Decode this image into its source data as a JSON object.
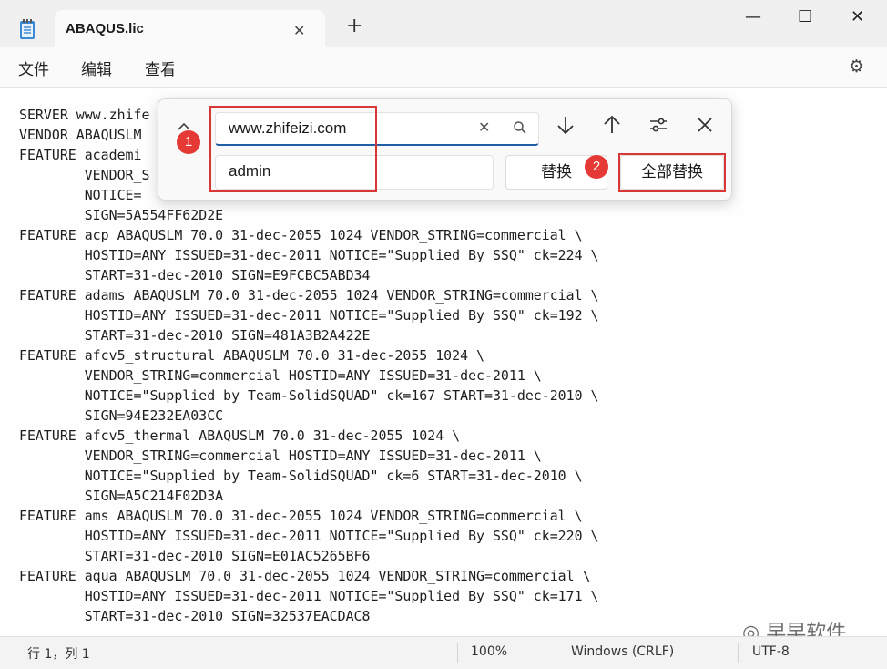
{
  "window": {
    "tab_title": "ABAQUS.lic",
    "tab_close": "✕",
    "new_tab": "+",
    "minimize": "—",
    "maximize": "☐",
    "close": "✕"
  },
  "menu": {
    "file": "文件",
    "edit": "编辑",
    "view": "查看"
  },
  "find_replace": {
    "find_value": "www.zhifeizi.com",
    "replace_value": "admin",
    "replace_label": "替换",
    "replace_all_label": "全部替换",
    "badge_1": "1",
    "badge_2": "2"
  },
  "editor_lines": [
    "SERVER www.zhife",
    "VENDOR ABAQUSLM",
    "FEATURE academi",
    "        VENDOR_S",
    "        NOTICE=",
    "        SIGN=5A554FF62D2E",
    "FEATURE acp ABAQUSLM 70.0 31-dec-2055 1024 VENDOR_STRING=commercial \\",
    "        HOSTID=ANY ISSUED=31-dec-2011 NOTICE=\"Supplied By SSQ\" ck=224 \\",
    "        START=31-dec-2010 SIGN=E9FCBC5ABD34",
    "FEATURE adams ABAQUSLM 70.0 31-dec-2055 1024 VENDOR_STRING=commercial \\",
    "        HOSTID=ANY ISSUED=31-dec-2011 NOTICE=\"Supplied By SSQ\" ck=192 \\",
    "        START=31-dec-2010 SIGN=481A3B2A422E",
    "FEATURE afcv5_structural ABAQUSLM 70.0 31-dec-2055 1024 \\",
    "        VENDOR_STRING=commercial HOSTID=ANY ISSUED=31-dec-2011 \\",
    "        NOTICE=\"Supplied by Team-SolidSQUAD\" ck=167 START=31-dec-2010 \\",
    "        SIGN=94E232EA03CC",
    "FEATURE afcv5_thermal ABAQUSLM 70.0 31-dec-2055 1024 \\",
    "        VENDOR_STRING=commercial HOSTID=ANY ISSUED=31-dec-2011 \\",
    "        NOTICE=\"Supplied by Team-SolidSQUAD\" ck=6 START=31-dec-2010 \\",
    "        SIGN=A5C214F02D3A",
    "FEATURE ams ABAQUSLM 70.0 31-dec-2055 1024 VENDOR_STRING=commercial \\",
    "        HOSTID=ANY ISSUED=31-dec-2011 NOTICE=\"Supplied By SSQ\" ck=220 \\",
    "        START=31-dec-2010 SIGN=E01AC5265BF6",
    "FEATURE aqua ABAQUSLM 70.0 31-dec-2055 1024 VENDOR_STRING=commercial \\",
    "        HOSTID=ANY ISSUED=31-dec-2011 NOTICE=\"Supplied By SSQ\" ck=171 \\",
    "        START=31-dec-2010 SIGN=32537EACDAC8"
  ],
  "status": {
    "position": "行 1，列 1",
    "zoom": "100%",
    "line_ending": "Windows (CRLF)",
    "encoding": "UTF-8"
  },
  "watermark": "早早软件",
  "colors": {
    "accent": "#1f5fa8",
    "highlight": "#d93636",
    "badge": "#e53935"
  }
}
